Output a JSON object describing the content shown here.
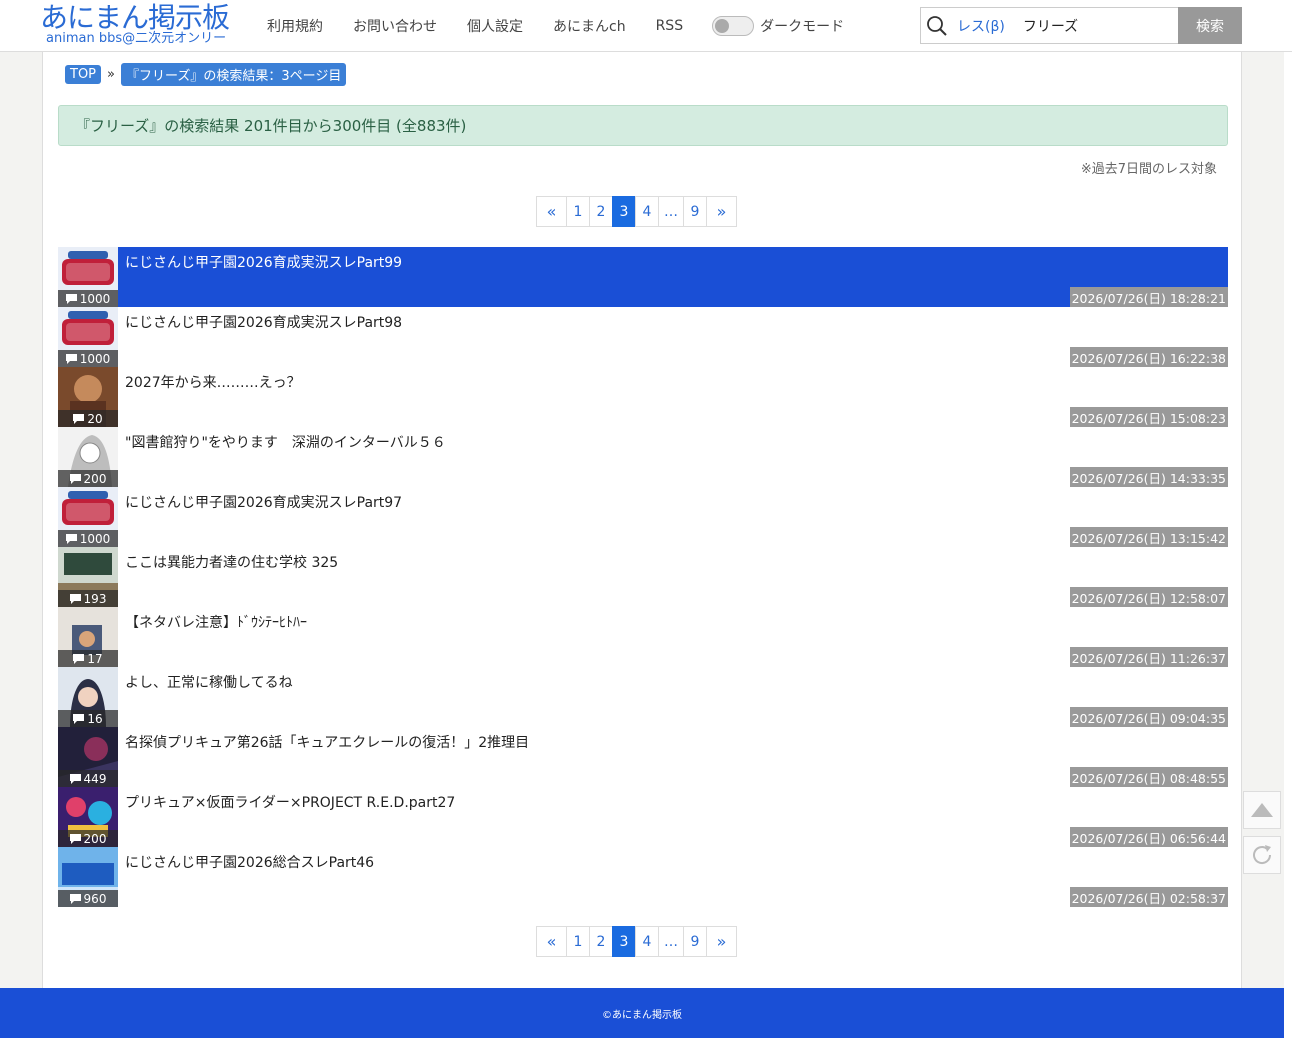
{
  "header": {
    "logo_main": "あにまん掲示板",
    "logo_sub": "animan bbs@二次元オンリー",
    "nav": [
      "利用規約",
      "お問い合わせ",
      "個人設定",
      "あにまんch",
      "RSS"
    ],
    "dark_mode_label": "ダークモード",
    "search_scope": "レス(β)",
    "search_value": "フリーズ",
    "search_button": "検索"
  },
  "breadcrumb": {
    "top": "TOP",
    "sep": "»",
    "current": "『フリーズ』の検索結果：3ページ目"
  },
  "result_summary": "『フリーズ』の検索結果 201件目から300件目 (全883件)",
  "note": "※過去7日間のレス対象",
  "pagination": {
    "prev": "«",
    "pages": [
      "1",
      "2",
      "3",
      "4",
      "…",
      "9"
    ],
    "current": "3",
    "next": "»"
  },
  "threads": [
    {
      "title": "にじさんじ甲子園2026育成実況スレPart99",
      "count": "1000",
      "date": "2026/07/26(日) 18:28:21",
      "thumb": "koshien"
    },
    {
      "title": "にじさんじ甲子園2026育成実況スレPart98",
      "count": "1000",
      "date": "2026/07/26(日) 16:22:38",
      "thumb": "koshien"
    },
    {
      "title": "2027年から来………えっ？",
      "count": "20",
      "date": "2026/07/26(日) 15:08:23",
      "thumb": "brown"
    },
    {
      "title": "\"図書館狩り\"をやります　深淵のインターバル５６",
      "count": "200",
      "date": "2026/07/26(日) 14:33:35",
      "thumb": "manga"
    },
    {
      "title": "にじさんじ甲子園2026育成実況スレPart97",
      "count": "1000",
      "date": "2026/07/26(日) 13:15:42",
      "thumb": "koshien"
    },
    {
      "title": "ここは異能力者達の住む学校 325",
      "count": "193",
      "date": "2026/07/26(日) 12:58:07",
      "thumb": "classroom"
    },
    {
      "title": "【ネタバレ注意】ﾄﾞｳｼﾃｰﾋﾄﾊｰ",
      "count": "17",
      "date": "2026/07/26(日) 11:26:37",
      "thumb": "poster"
    },
    {
      "title": "よし、正常に稼働してるね",
      "count": "16",
      "date": "2026/07/26(日) 09:04:35",
      "thumb": "girl"
    },
    {
      "title": "名探偵プリキュア第26話「キュアエクレールの復活！」2推理目",
      "count": "449",
      "date": "2026/07/26(日) 08:48:55",
      "thumb": "dark"
    },
    {
      "title": "プリキュア×仮面ライダー×PROJECT R.E.D.part27",
      "count": "200",
      "date": "2026/07/26(日) 06:56:44",
      "thumb": "colorful"
    },
    {
      "title": "にじさんじ甲子園2026総合スレPart46",
      "count": "960",
      "date": "2026/07/26(日) 02:58:37",
      "thumb": "blue"
    }
  ],
  "footer": "©あにまん掲示板",
  "icons": {
    "search": "search-icon",
    "comment": "comment-icon",
    "scroll_top": "arrow-up-icon",
    "reload": "reload-icon"
  },
  "colors": {
    "brand": "#2a6bd4",
    "selected_row": "#1a4fd6",
    "footer": "#1a4fd6"
  }
}
